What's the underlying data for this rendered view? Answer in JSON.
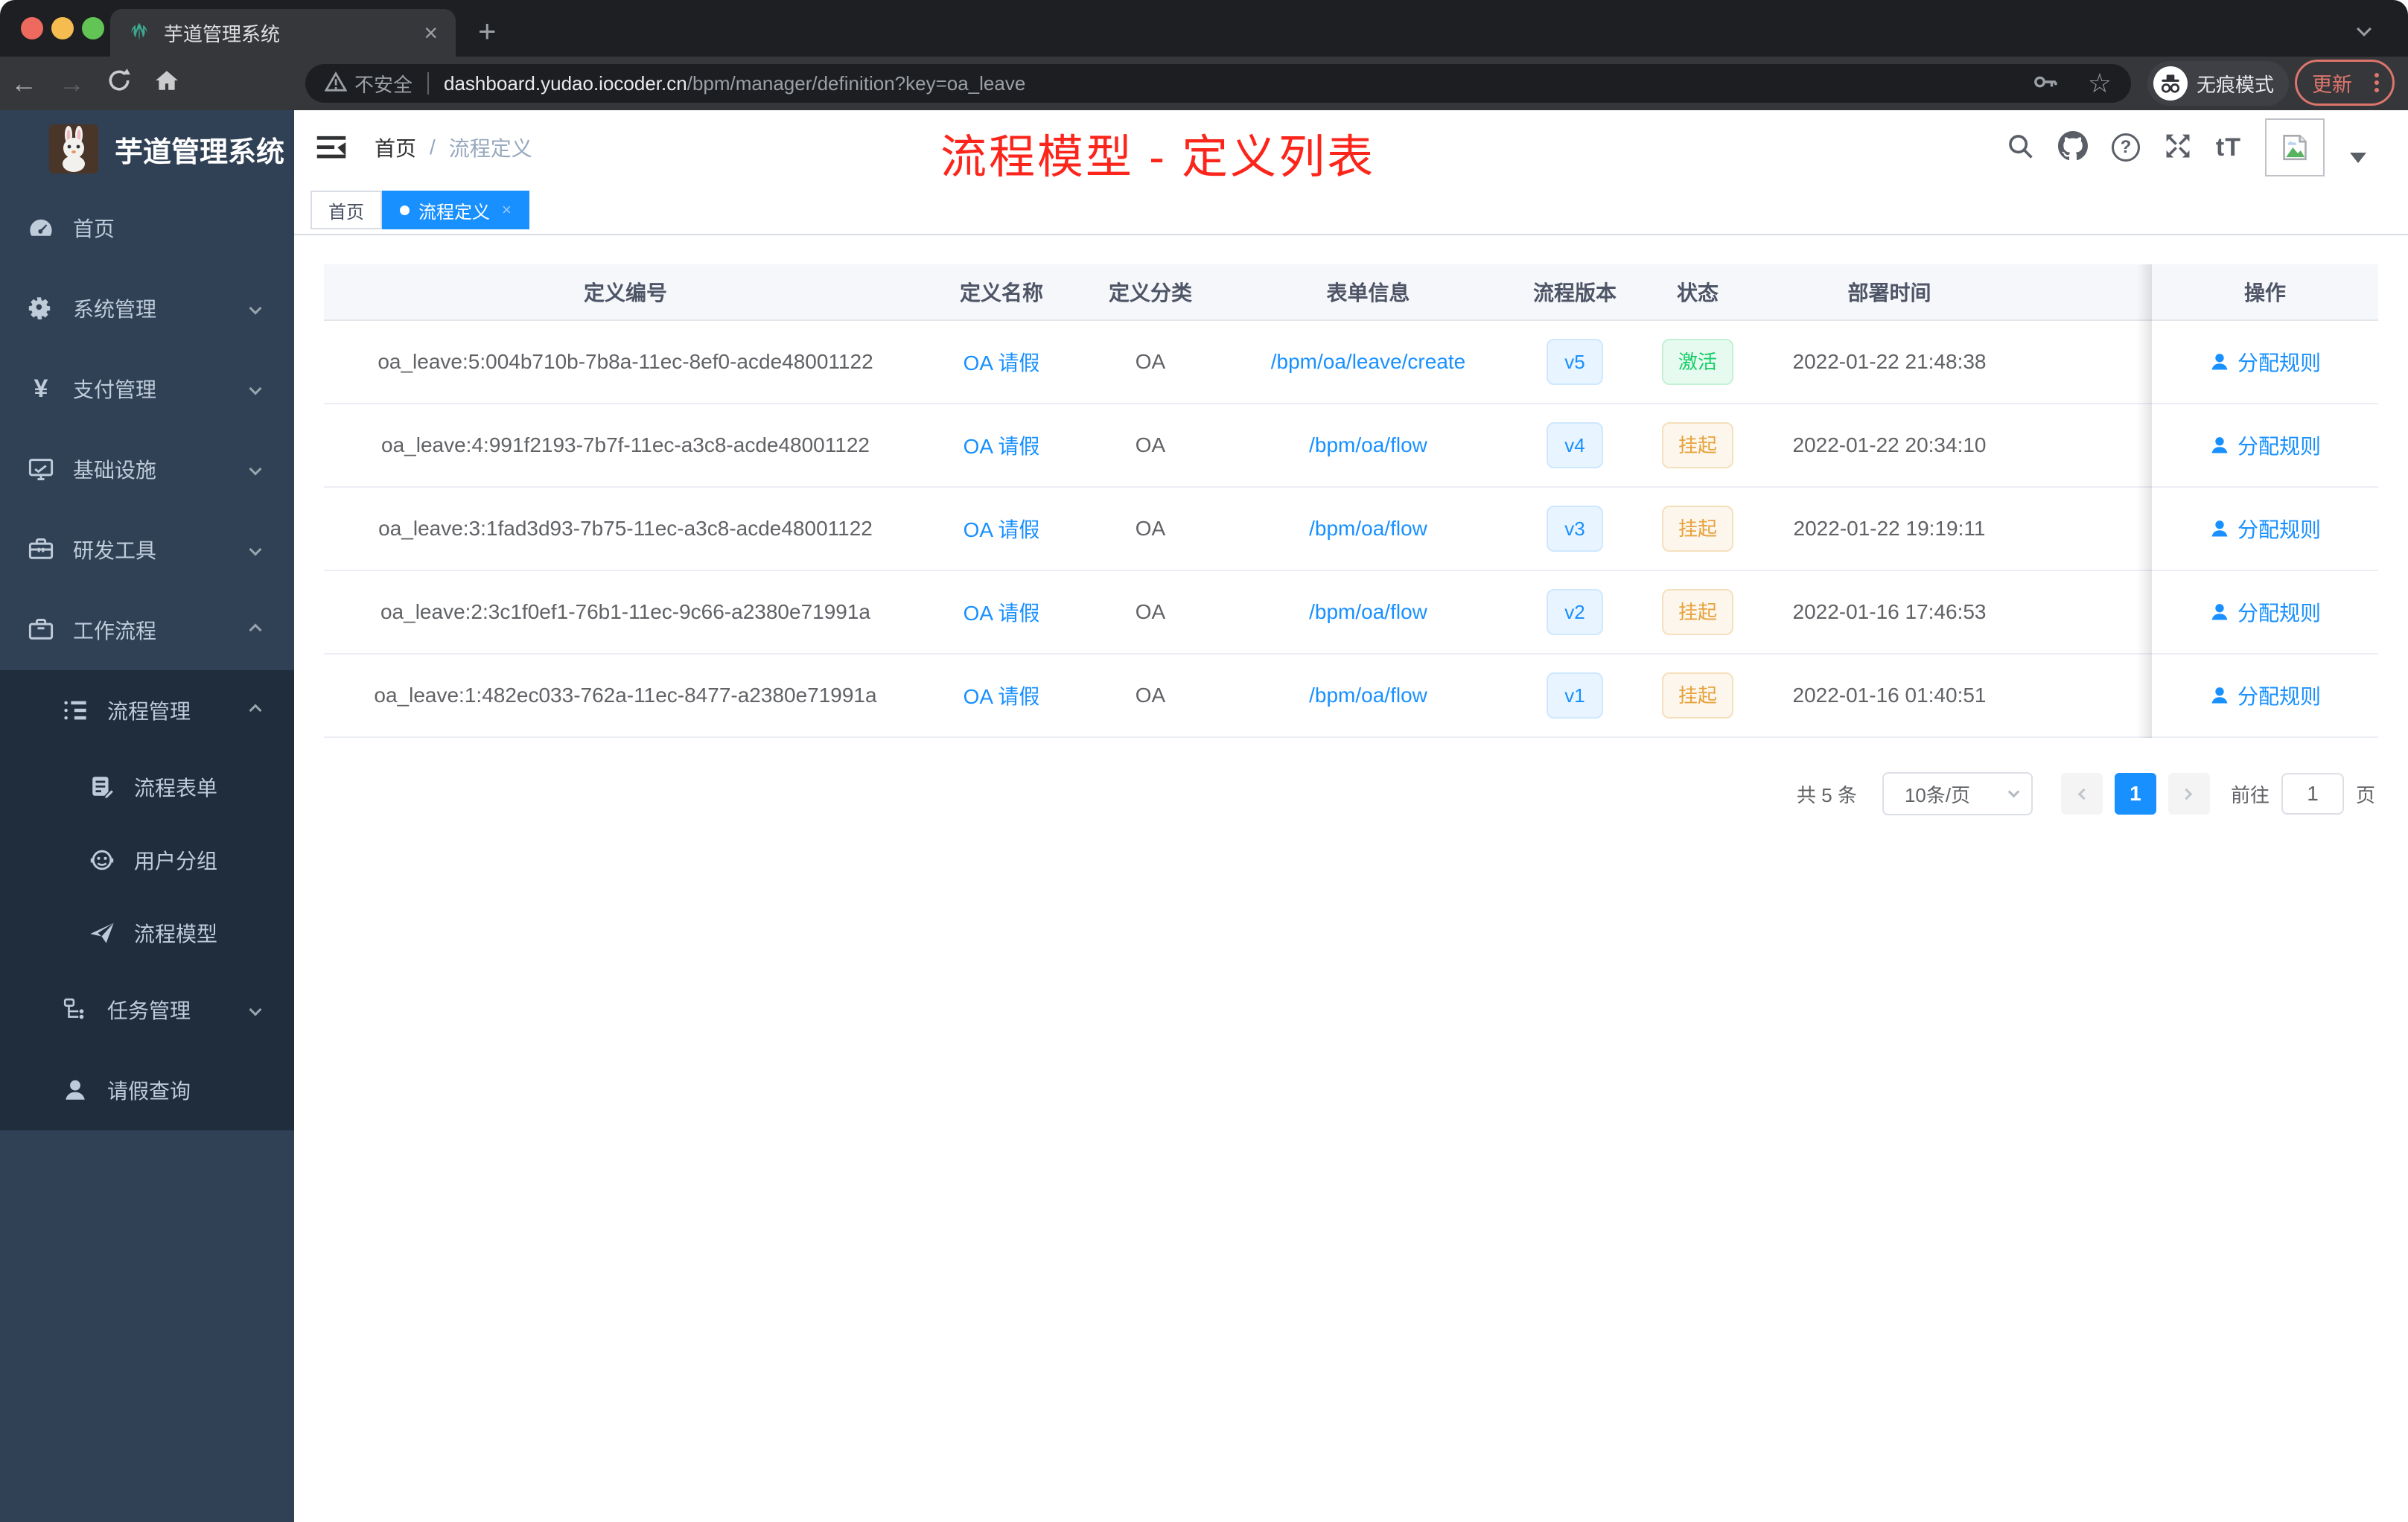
{
  "browser": {
    "tab": {
      "title": "芋道管理系统",
      "close_glyph": "×",
      "new_tab_glyph": "+"
    },
    "nav": {
      "back_glyph": "←",
      "forward_glyph": "→"
    },
    "address": {
      "warning_label": "不安全",
      "domain": "dashboard.yudao.iocoder.cn",
      "path": "/bpm/manager/definition?key=oa_leave"
    },
    "incognito_label": "无痕模式",
    "update_label": "更新"
  },
  "sidebar": {
    "title": "芋道管理系统",
    "items": [
      {
        "label": "首页",
        "icon": "dashboard-icon"
      },
      {
        "label": "系统管理",
        "icon": "gear-icon",
        "chevron": "down"
      },
      {
        "label": "支付管理",
        "icon": "yen-icon",
        "chevron": "down"
      },
      {
        "label": "基础设施",
        "icon": "monitor-icon",
        "chevron": "down"
      },
      {
        "label": "研发工具",
        "icon": "toolbox-icon",
        "chevron": "down"
      },
      {
        "label": "工作流程",
        "icon": "briefcase-icon",
        "chevron": "up"
      },
      {
        "label": "流程管理",
        "icon": "list-icon",
        "chevron": "up"
      },
      {
        "label": "流程表单",
        "icon": "form-icon"
      },
      {
        "label": "用户分组",
        "icon": "group-icon"
      },
      {
        "label": "流程模型",
        "icon": "paper-plane-icon"
      },
      {
        "label": "任务管理",
        "icon": "tree-icon",
        "chevron": "down"
      },
      {
        "label": "请假查询",
        "icon": "user-icon"
      }
    ],
    "yen_glyph": "¥"
  },
  "navbar": {
    "breadcrumb": {
      "home": "首页",
      "separator": "/",
      "current": "流程定义"
    },
    "annotation": "流程模型 - 定义列表",
    "help_glyph": "?",
    "fontsize_glyph": "tT"
  },
  "tags": {
    "home_label": "首页",
    "active_label": "流程定义",
    "active_close_glyph": "×"
  },
  "table": {
    "columns": {
      "id": "定义编号",
      "name": "定义名称",
      "category": "定义分类",
      "form": "表单信息",
      "version": "流程版本",
      "status": "状态",
      "deploy_time": "部署时间",
      "action": "操作"
    },
    "rows": [
      {
        "id": "oa_leave:5:004b710b-7b8a-11ec-8ef0-acde48001122",
        "name": "OA 请假",
        "category": "OA",
        "form": "/bpm/oa/leave/create",
        "version": "v5",
        "status": "激活",
        "status_type": "active",
        "deploy_time": "2022-01-22 21:48:38",
        "action": "分配规则"
      },
      {
        "id": "oa_leave:4:991f2193-7b7f-11ec-a3c8-acde48001122",
        "name": "OA 请假",
        "category": "OA",
        "form": "/bpm/oa/flow",
        "version": "v4",
        "status": "挂起",
        "status_type": "suspended",
        "deploy_time": "2022-01-22 20:34:10",
        "action": "分配规则"
      },
      {
        "id": "oa_leave:3:1fad3d93-7b75-11ec-a3c8-acde48001122",
        "name": "OA 请假",
        "category": "OA",
        "form": "/bpm/oa/flow",
        "version": "v3",
        "status": "挂起",
        "status_type": "suspended",
        "deploy_time": "2022-01-22 19:19:11",
        "action": "分配规则"
      },
      {
        "id": "oa_leave:2:3c1f0ef1-76b1-11ec-9c66-a2380e71991a",
        "name": "OA 请假",
        "category": "OA",
        "form": "/bpm/oa/flow",
        "version": "v2",
        "status": "挂起",
        "status_type": "suspended",
        "deploy_time": "2022-01-16 17:46:53",
        "action": "分配规则"
      },
      {
        "id": "oa_leave:1:482ec033-762a-11ec-8477-a2380e71991a",
        "name": "OA 请假",
        "category": "OA",
        "form": "/bpm/oa/flow",
        "version": "v1",
        "status": "挂起",
        "status_type": "suspended",
        "deploy_time": "2022-01-16 01:40:51",
        "action": "分配规则"
      }
    ]
  },
  "pagination": {
    "total": "共 5 条",
    "page_size": "10条/页",
    "current_page": "1",
    "goto_label": "前往",
    "goto_value": "1",
    "page_unit": "页"
  },
  "colors": {
    "primary": "#1890ff",
    "success": "#13ce66",
    "warning": "#e6a23c",
    "annotation_red": "#fb251b",
    "sidebar_bg": "#304156",
    "submenu_bg": "#1f2d3d"
  }
}
